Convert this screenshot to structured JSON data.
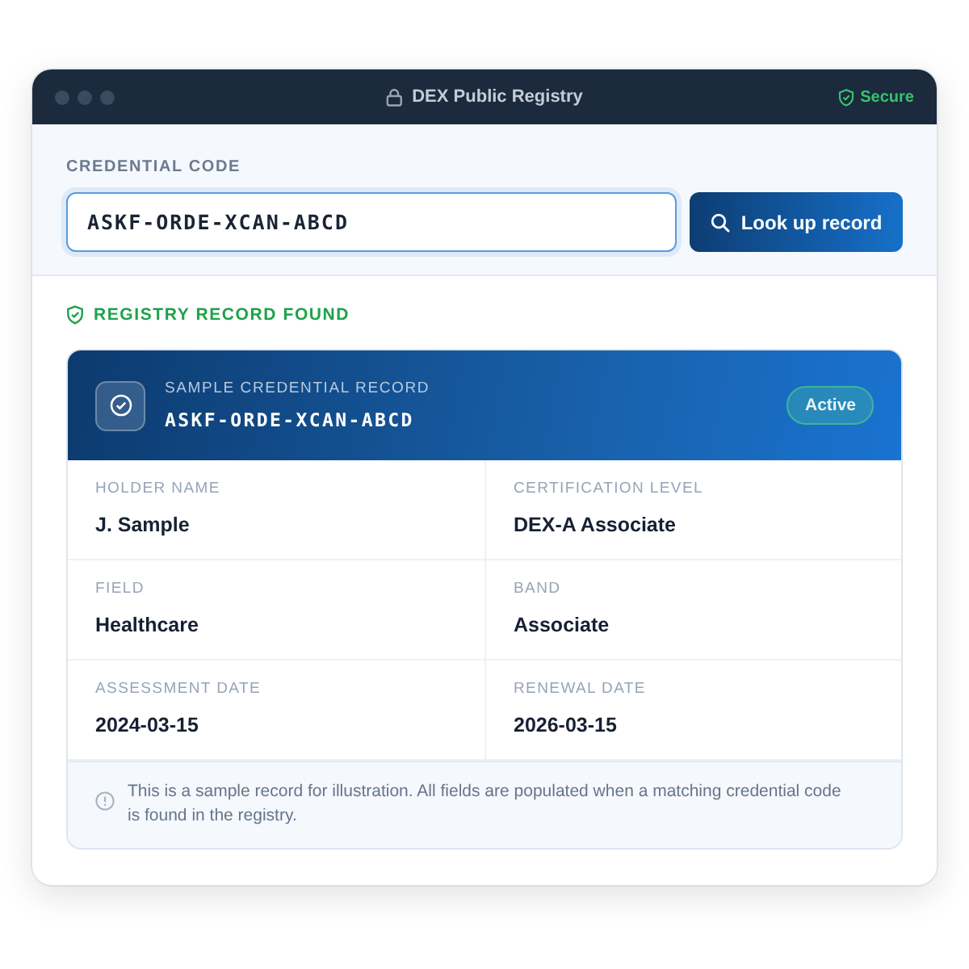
{
  "window": {
    "title": "DEX Public Registry",
    "secure_label": "Secure"
  },
  "search": {
    "label": "CREDENTIAL CODE",
    "value": "ASKF-ORDE-XCAN-ABCD",
    "button": "Look up record"
  },
  "result": {
    "status": "REGISTRY RECORD FOUND",
    "caption": "SAMPLE CREDENTIAL RECORD",
    "code": "ASKF-ORDE-XCAN-ABCD",
    "badge": "Active",
    "fields": [
      {
        "label": "HOLDER NAME",
        "value": "J. Sample"
      },
      {
        "label": "CERTIFICATION LEVEL",
        "value": "DEX-A Associate"
      },
      {
        "label": "FIELD",
        "value": "Healthcare"
      },
      {
        "label": "BAND",
        "value": "Associate"
      },
      {
        "label": "ASSESSMENT DATE",
        "value": "2024-03-15"
      },
      {
        "label": "RENEWAL DATE",
        "value": "2026-03-15"
      }
    ],
    "note": "This is a sample record for illustration. All fields are populated when a matching credential code is found in the registry."
  }
}
